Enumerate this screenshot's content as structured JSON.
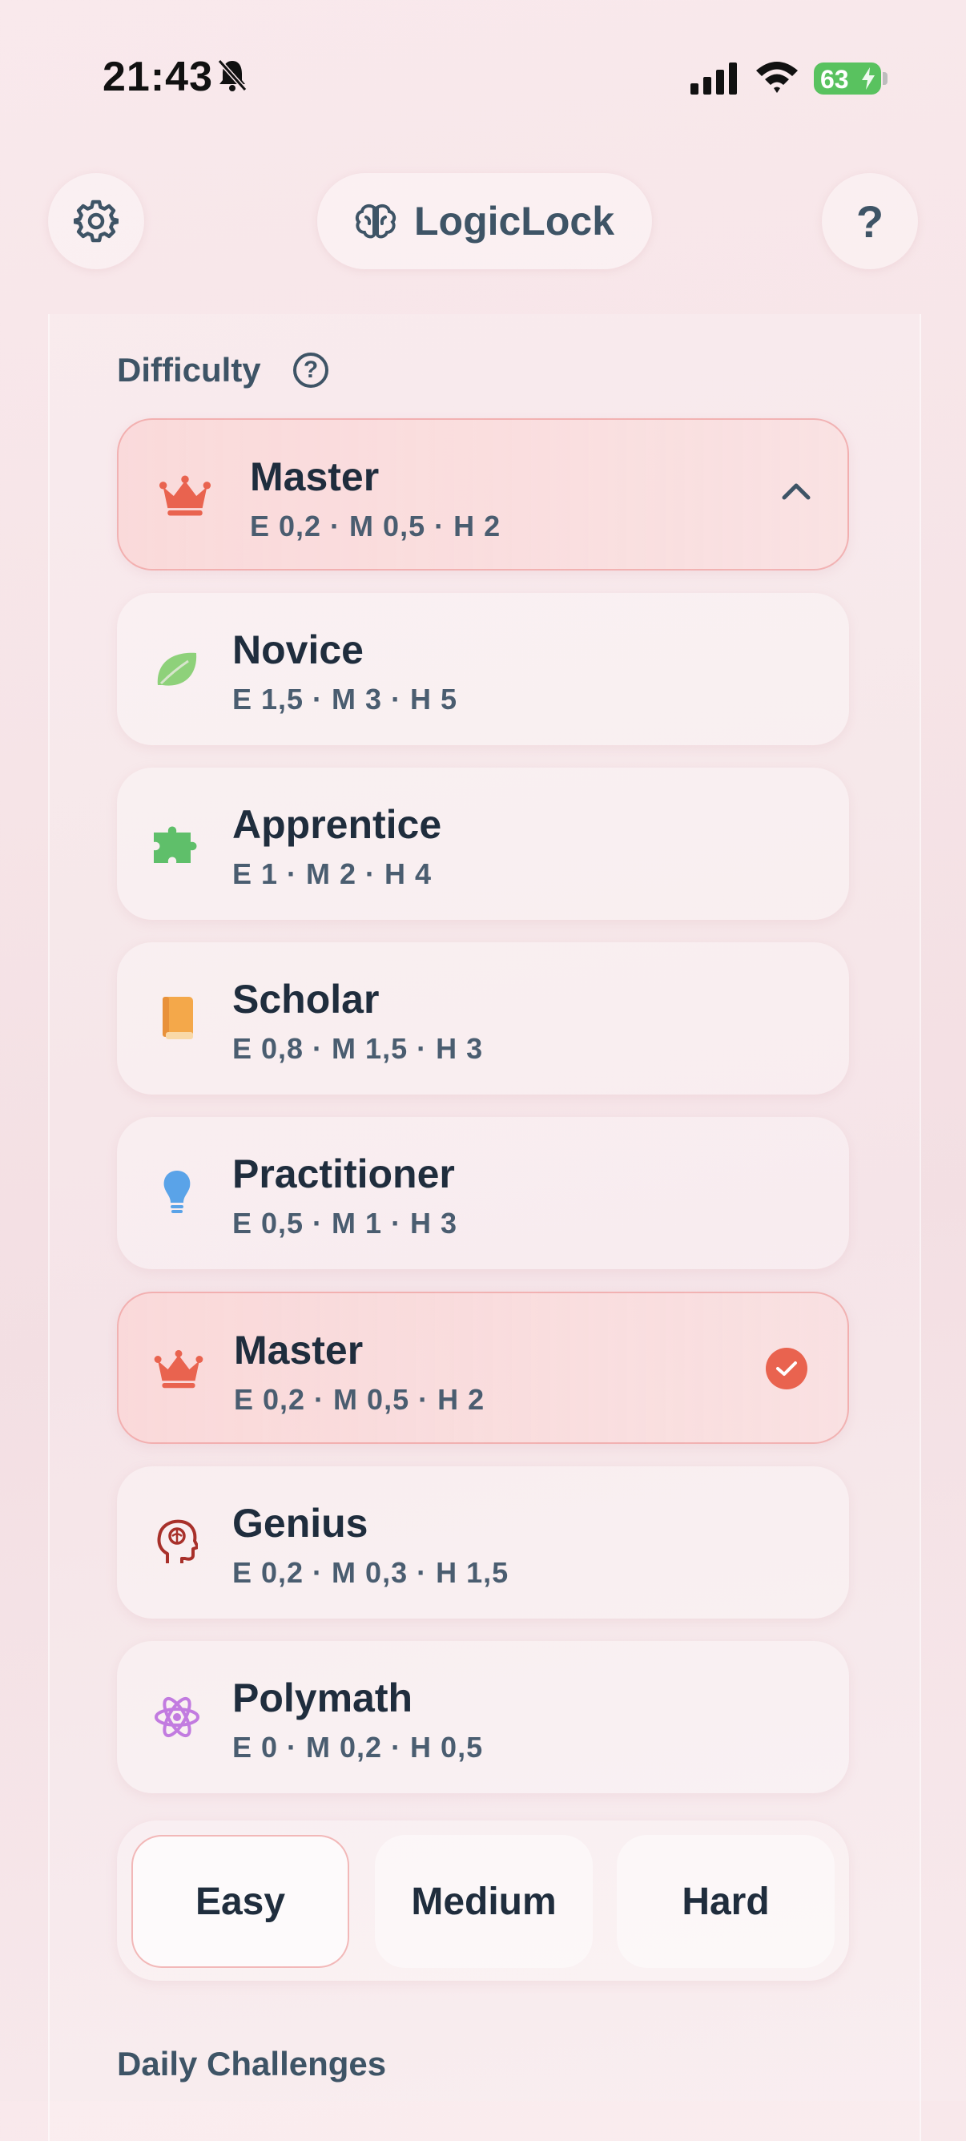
{
  "status_bar": {
    "time": "21:43",
    "battery": "63"
  },
  "header": {
    "title": "LogicLock",
    "help_label": "?"
  },
  "difficulty": {
    "section_label": "Difficulty",
    "info_label": "?",
    "current": {
      "name": "Master",
      "detail": "E 0,2 · M 0,5 · H 2"
    },
    "options": [
      {
        "name": "Novice",
        "detail": "E 1,5 · M 3 · H 5",
        "icon": "leaf-icon",
        "selected": false
      },
      {
        "name": "Apprentice",
        "detail": "E 1 · M 2 · H 4",
        "icon": "puzzle-icon",
        "selected": false
      },
      {
        "name": "Scholar",
        "detail": "E 0,8 · M 1,5 · H 3",
        "icon": "book-icon",
        "selected": false
      },
      {
        "name": "Practitioner",
        "detail": "E 0,5 · M 1 · H 3",
        "icon": "lightbulb-icon",
        "selected": false
      },
      {
        "name": "Master",
        "detail": "E 0,2 · M 0,5 · H 2",
        "icon": "crown-icon",
        "selected": true
      },
      {
        "name": "Genius",
        "detail": "E 0,2 · M 0,3 · H 1,5",
        "icon": "brain-head-icon",
        "selected": false
      },
      {
        "name": "Polymath",
        "detail": "E 0 · M 0,2 · H 0,5",
        "icon": "atom-icon",
        "selected": false
      }
    ]
  },
  "level_selector": {
    "options": [
      "Easy",
      "Medium",
      "Hard"
    ],
    "active": "Easy"
  },
  "daily": {
    "section_label": "Daily Challenges"
  },
  "colors": {
    "accent": "#e9634f",
    "text": "#1f2d3d",
    "muted": "#3e5466"
  }
}
